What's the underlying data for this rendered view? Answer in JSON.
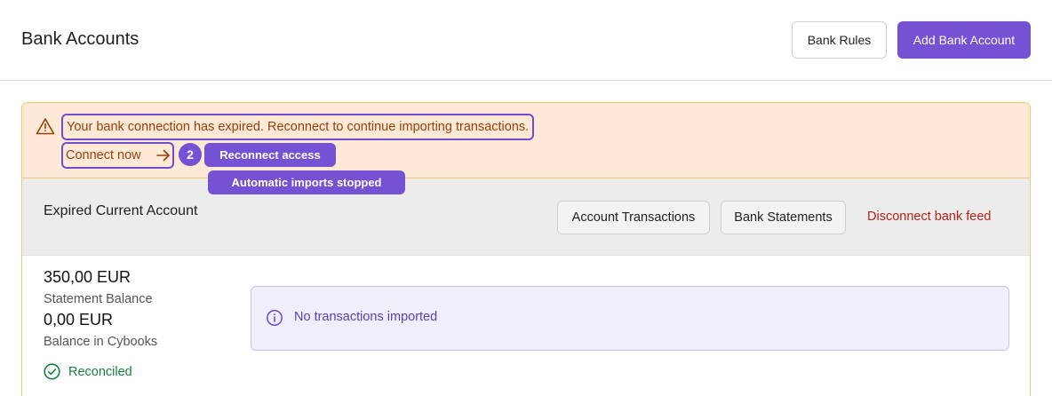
{
  "header": {
    "title": "Bank Accounts",
    "bank_rules_label": "Bank Rules",
    "add_account_label": "Add Bank Account"
  },
  "alert": {
    "message": "Your bank connection has expired. Reconnect to continue importing transactions.",
    "connect_label": "Connect now",
    "step_number": "2",
    "tooltip_primary": "Reconnect access",
    "tooltip_secondary": "Automatic imports stopped",
    "icons": [
      "warning-triangle-icon",
      "arrow-right-icon"
    ]
  },
  "account": {
    "name": "Expired Current Account",
    "transactions_label": "Account Transactions",
    "statements_label": "Bank Statements",
    "disconnect_label": "Disconnect bank feed",
    "statement_balance": "350,00 EUR",
    "statement_balance_label": "Statement Balance",
    "cybooks_balance": "0,00 EUR",
    "cybooks_balance_label": "Balance in Cybooks",
    "status": "Reconciled",
    "info_message": "No transactions imported"
  },
  "colors": {
    "accent": "#7452d3",
    "alert_bg": "#fee9d6",
    "alert_text": "#9a3f0a",
    "danger": "#b42318",
    "success": "#15803d"
  }
}
